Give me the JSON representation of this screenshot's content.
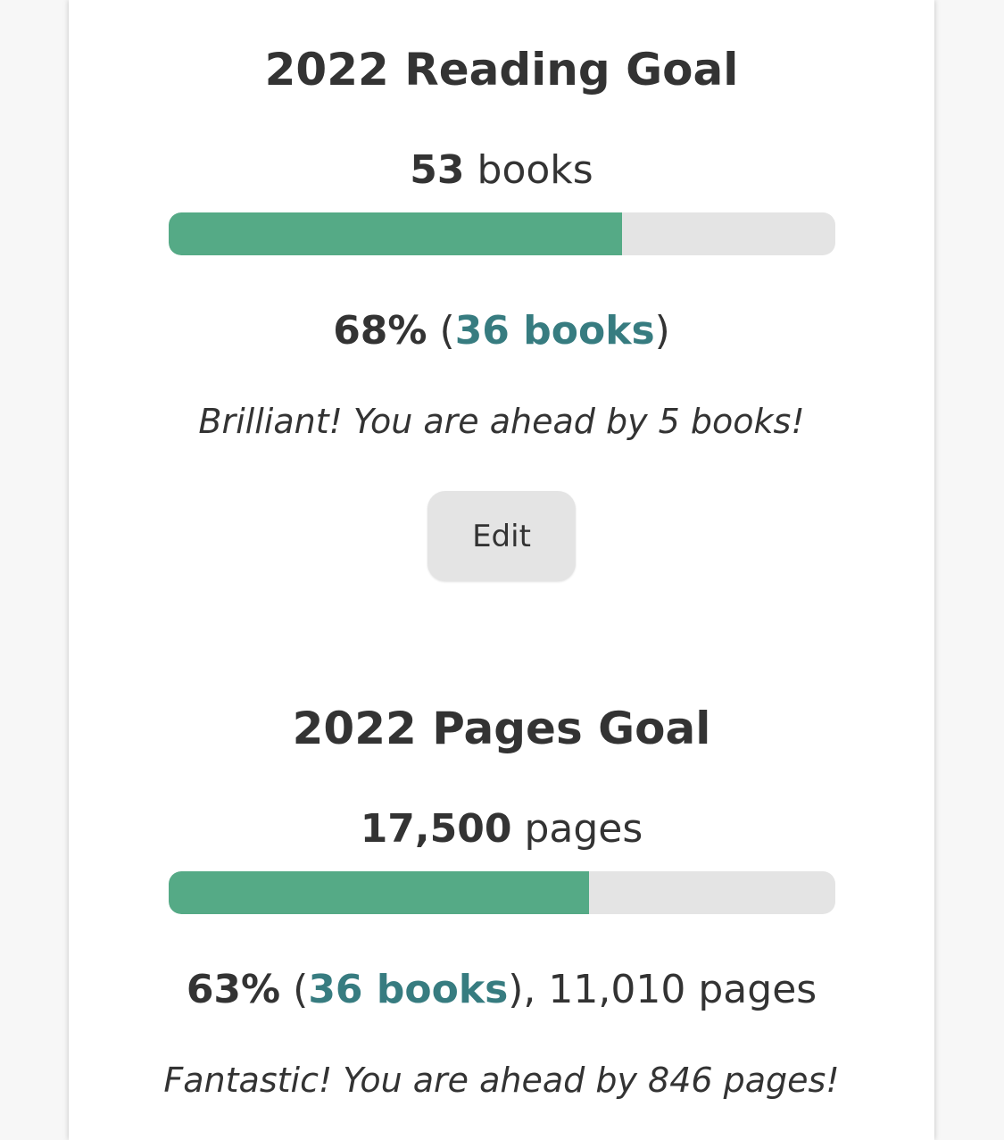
{
  "reading_goal": {
    "title": "2022 Reading Goal",
    "target_number": "53",
    "target_unit": "books",
    "progress_fraction": 0.68,
    "percent": "68%",
    "books_link": "36 books",
    "message": "Brilliant! You are ahead by 5 books!",
    "edit_label": "Edit"
  },
  "pages_goal": {
    "title": "2022 Pages Goal",
    "target_number": "17,500",
    "target_unit": "pages",
    "progress_fraction": 0.63,
    "percent": "63%",
    "books_link": "36 books",
    "pages_read": "11,010 pages",
    "message": "Fantastic! You are ahead by 846 pages!"
  },
  "colors": {
    "progress_fill": "#55aa86",
    "progress_track": "#e4e4e4",
    "link": "#377c80",
    "text": "#333333"
  }
}
